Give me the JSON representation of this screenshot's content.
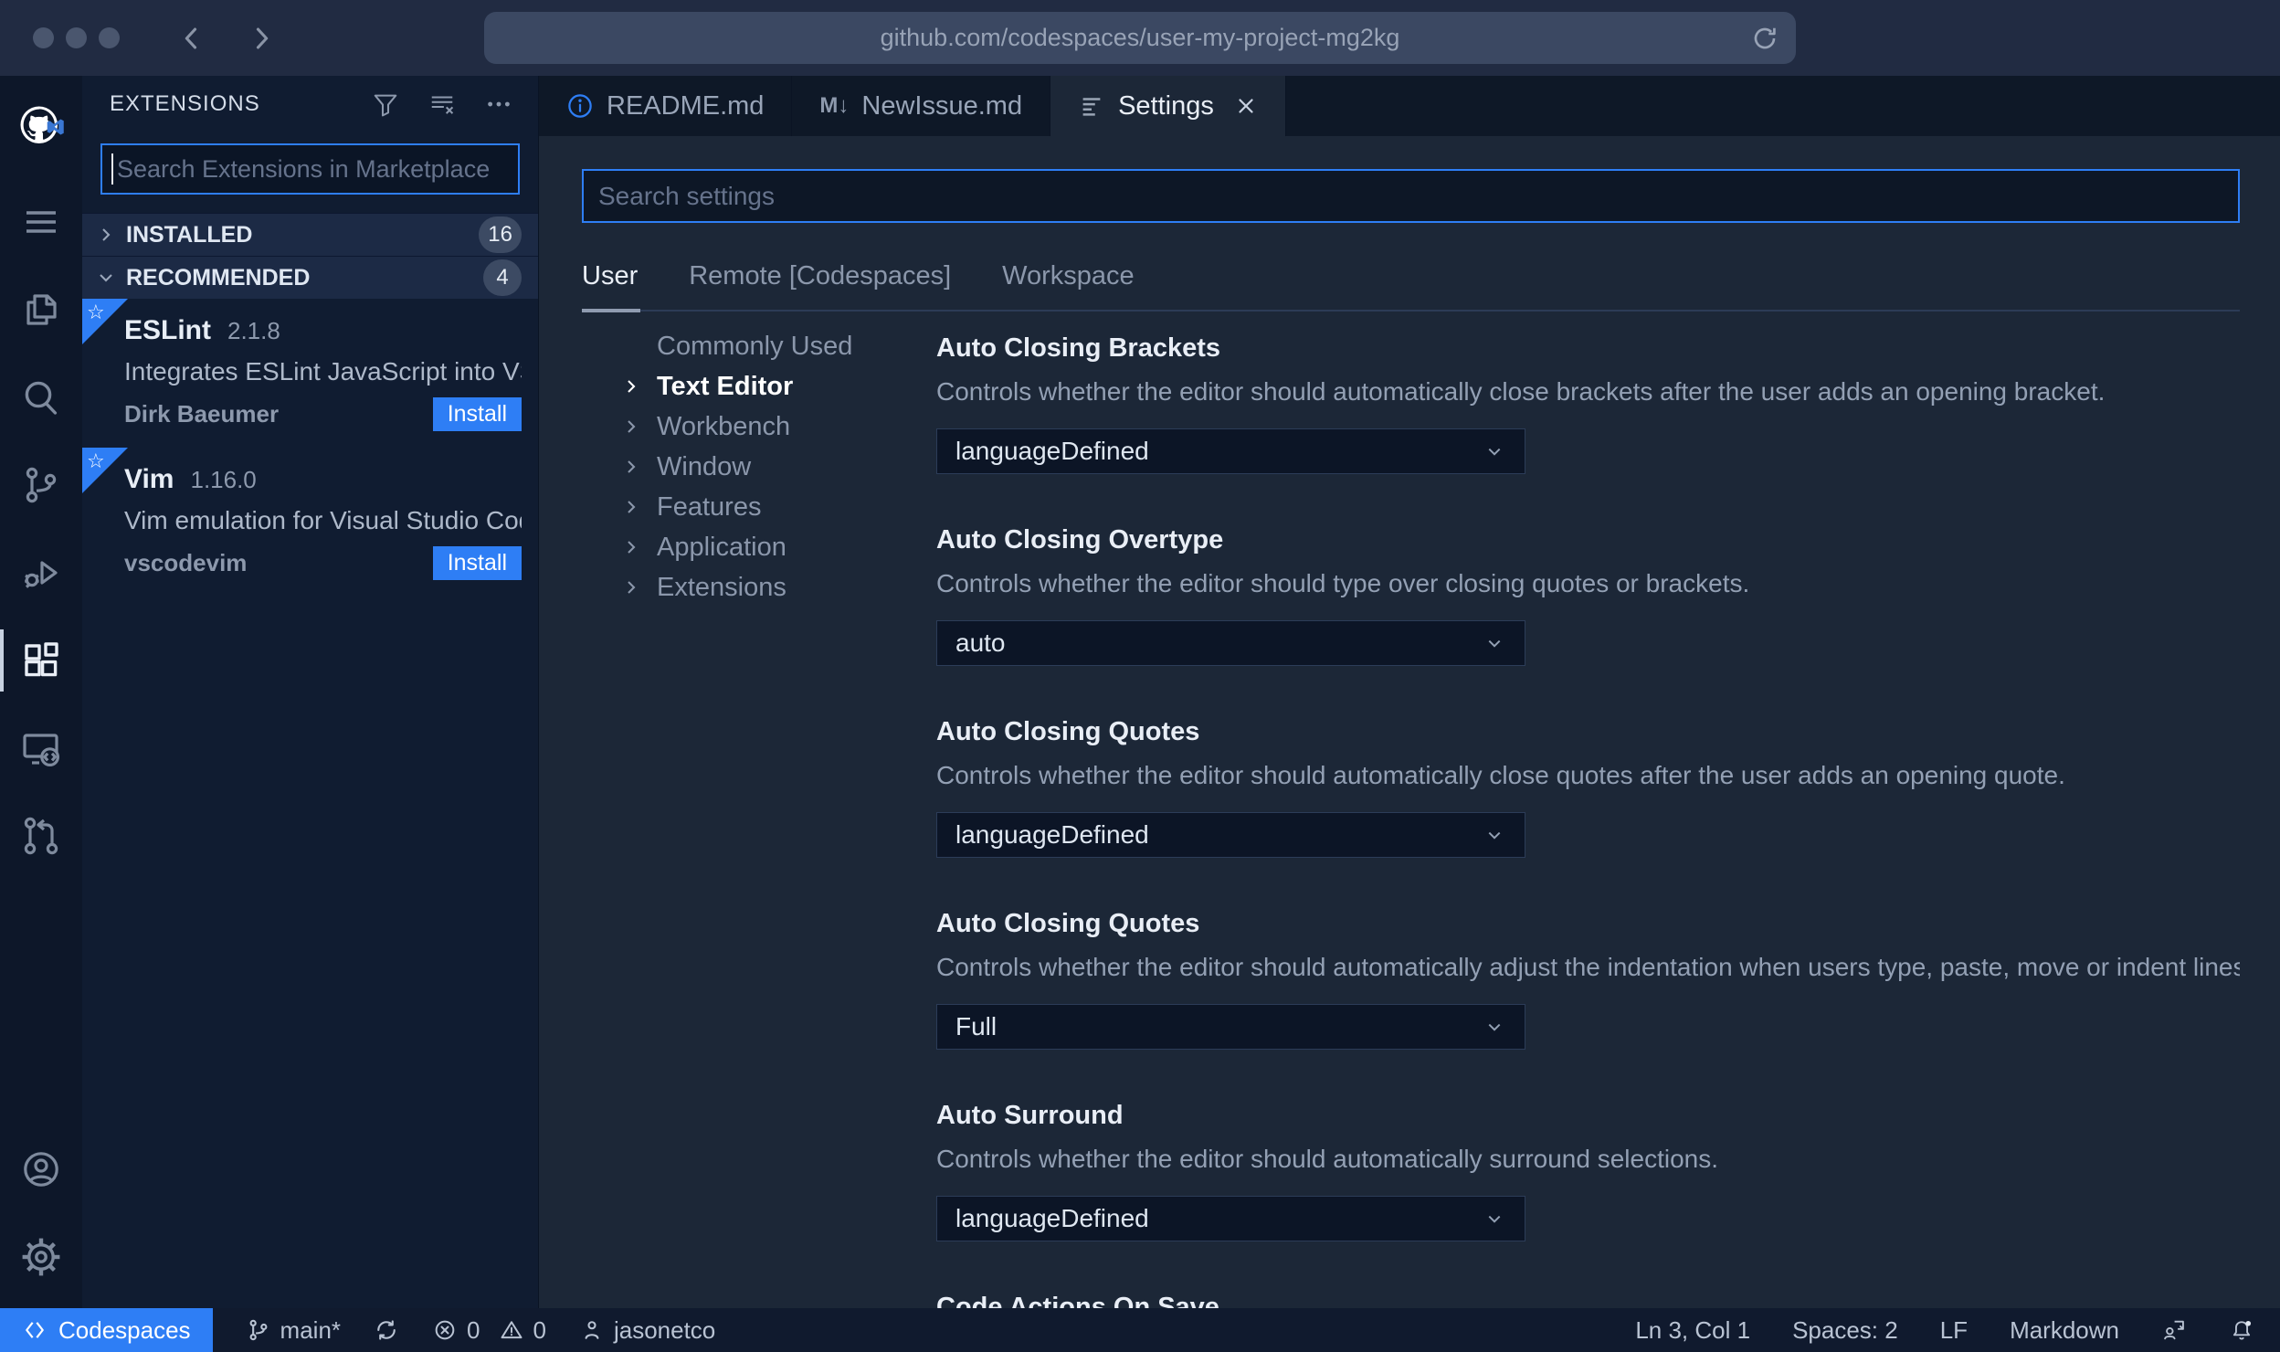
{
  "browser": {
    "url": "github.com/codespaces/user-my-project-mg2kg"
  },
  "colors": {
    "accent": "#2e7ef5",
    "install_button": "#2e7ef5",
    "status_segment": "#2e7ef5",
    "badge_bg": "#3c4a63",
    "editor_bg": "#1c2737",
    "activitybar_bg": "#0d1729",
    "sidebar_bg": "#101c31"
  },
  "activity_bar": {
    "items": [
      {
        "icon": "github-vscode-logo"
      },
      {
        "icon": "menu-icon"
      },
      {
        "icon": "explorer-icon"
      },
      {
        "icon": "search-icon"
      },
      {
        "icon": "source-control-icon"
      },
      {
        "icon": "run-debug-icon"
      },
      {
        "icon": "extensions-icon",
        "active": true
      },
      {
        "icon": "remote-explorer-icon"
      },
      {
        "icon": "pull-requests-icon"
      },
      {
        "icon": "account-icon"
      },
      {
        "icon": "gear-icon"
      }
    ]
  },
  "sidebar": {
    "title": "EXTENSIONS",
    "actions": [
      {
        "icon": "filter-icon"
      },
      {
        "icon": "clear-list-icon"
      },
      {
        "icon": "more-actions-icon"
      }
    ],
    "search_placeholder": "Search Extensions in Marketplace",
    "sections": [
      {
        "label": "INSTALLED",
        "count": "16",
        "state": "collapsed"
      },
      {
        "label": "RECOMMENDED",
        "count": "4",
        "state": "expanded"
      }
    ],
    "extensions": [
      {
        "name": "ESLint",
        "version": "2.1.8",
        "description": "Integrates ESLint JavaScript into VS C...",
        "author": "Dirk Baeumer",
        "action": "Install"
      },
      {
        "name": "Vim",
        "version": "1.16.0",
        "description": "Vim emulation for Visual Studio Code...",
        "author": "vscodevim",
        "action": "Install"
      }
    ]
  },
  "editor": {
    "tabs": [
      {
        "label": "README.md",
        "icon": "info-icon"
      },
      {
        "label": "NewIssue.md",
        "icon": "markdown-icon",
        "icon_glyph": "M↓"
      },
      {
        "label": "Settings",
        "icon": "settings-list-icon",
        "active": true,
        "closable": true
      }
    ]
  },
  "settings": {
    "search_placeholder": "Search settings",
    "scopes": [
      {
        "label": "User",
        "active": true
      },
      {
        "label": "Remote [Codespaces]"
      },
      {
        "label": "Workspace"
      }
    ],
    "toc": [
      {
        "label": "Commonly Used"
      },
      {
        "label": "Text Editor",
        "active": true
      },
      {
        "label": "Workbench"
      },
      {
        "label": "Window"
      },
      {
        "label": "Features"
      },
      {
        "label": "Application"
      },
      {
        "label": "Extensions"
      }
    ],
    "entries": [
      {
        "title": "Auto Closing Brackets",
        "description": "Controls whether the editor should automatically close brackets after the user adds an opening bracket.",
        "value": "languageDefined"
      },
      {
        "title": "Auto Closing Overtype",
        "description": "Controls whether the editor should type over closing quotes or brackets.",
        "value": "auto"
      },
      {
        "title": "Auto Closing Quotes",
        "description": "Controls whether the editor should automatically close quotes after the user adds an opening quote.",
        "value": "languageDefined"
      },
      {
        "title": "Auto Closing Quotes",
        "description": "Controls whether the editor should automatically adjust the indentation when users type, paste, move or indent lines.",
        "value": "Full"
      },
      {
        "title": "Auto Surround",
        "description": "Controls whether the editor should automatically surround selections.",
        "value": "languageDefined"
      },
      {
        "title": "Code Actions On Save"
      }
    ]
  },
  "status_bar": {
    "left": {
      "codespaces": "Codespaces",
      "branch": "main*",
      "errors": "0",
      "warnings": "0",
      "user": "jasonetco"
    },
    "right": {
      "cursor": "Ln 3, Col 1",
      "indent": "Spaces: 2",
      "eol": "LF",
      "language": "Markdown"
    }
  }
}
